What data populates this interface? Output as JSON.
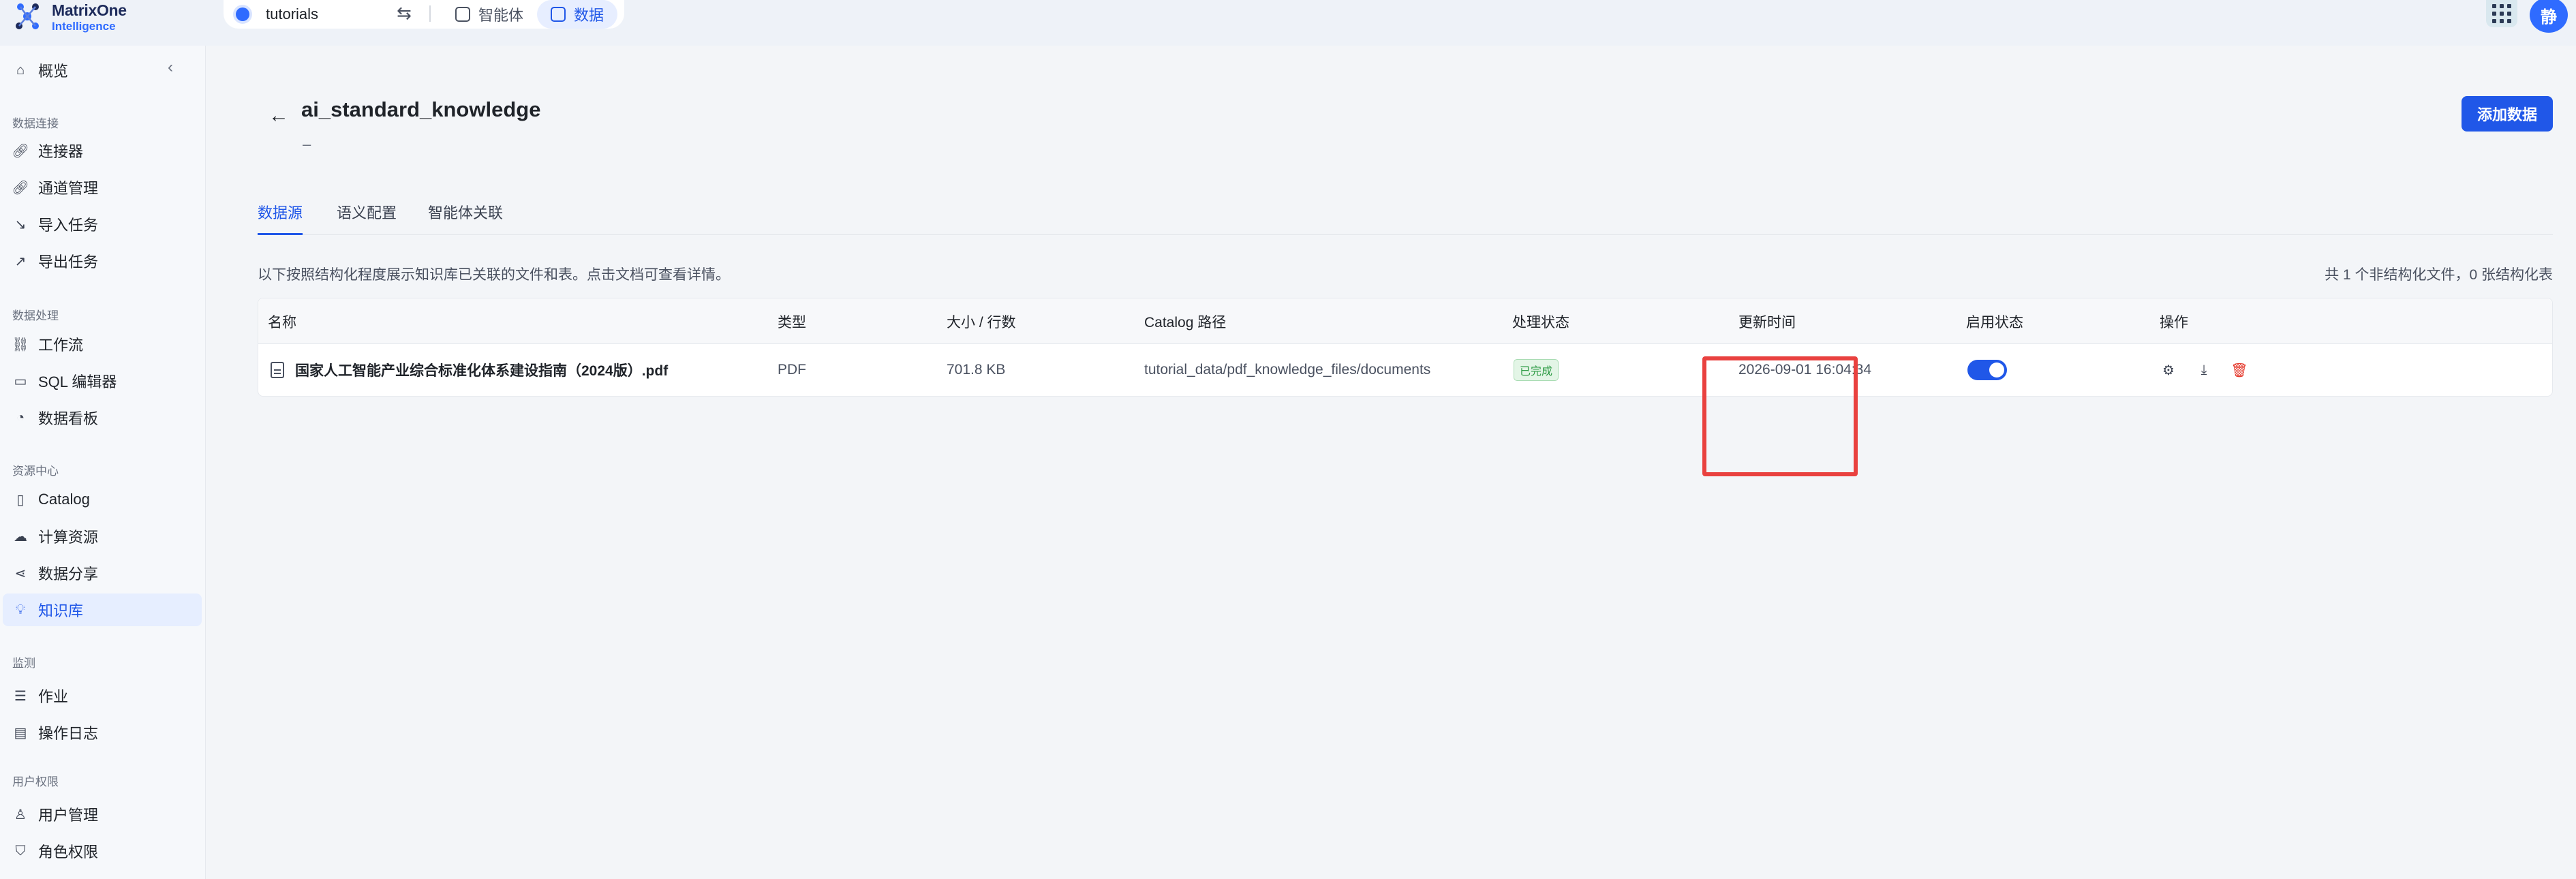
{
  "brand": {
    "name_line1": "MatrixOne",
    "name_line2": "Intelligence"
  },
  "workspace": {
    "name": "tutorials",
    "switch_icon": "swap-icon"
  },
  "nav_tabs": [
    {
      "label": "智能体",
      "icon": "agent-icon",
      "active": false
    },
    {
      "label": "数据",
      "icon": "data-icon",
      "active": true
    }
  ],
  "user": {
    "avatar_text": "静"
  },
  "sidebar": {
    "overview": "概览",
    "groups": {
      "data_connect": "数据连接",
      "data_process": "数据处理",
      "resource": "资源中心",
      "monitor": "监测",
      "permission": "用户权限"
    },
    "items": {
      "connectors": "连接器",
      "channels": "通道管理",
      "import_tasks": "导入任务",
      "export_tasks": "导出任务",
      "workflow": "工作流",
      "sql_editor": "SQL 编辑器",
      "dashboard": "数据看板",
      "catalog": "Catalog",
      "compute": "计算资源",
      "share": "数据分享",
      "knowledge": "知识库",
      "jobs": "作业",
      "op_logs": "操作日志",
      "users": "用户管理",
      "roles": "角色权限"
    }
  },
  "page": {
    "title": "ai_standard_knowledge",
    "subtitle": "–",
    "add_button": "添加数据",
    "tabs": [
      "数据源",
      "语义配置",
      "智能体关联"
    ],
    "active_tab": 0,
    "description": "以下按照结构化程度展示知识库已关联的文件和表。点击文档可查看详情。",
    "summary": "共 1 个非结构化文件，0 张结构化表"
  },
  "table": {
    "headers": {
      "name": "名称",
      "type": "类型",
      "size": "大小 / 行数",
      "path": "Catalog 路径",
      "status": "处理状态",
      "updated": "更新时间",
      "enabled": "启用状态",
      "actions": "操作"
    },
    "rows": [
      {
        "name": "国家人工智能产业综合标准化体系建设指南（2024版）.pdf",
        "type": "PDF",
        "size": "701.8 KB",
        "path": "tutorial_data/pdf_knowledge_files/documents",
        "status": "已完成",
        "updated": "2026-09-01 16:04:34",
        "enabled": true
      }
    ]
  },
  "colors": {
    "accent": "#2057e8",
    "success": "#2e9b45",
    "danger": "#e5372a",
    "highlight_box": "#e9413f"
  }
}
